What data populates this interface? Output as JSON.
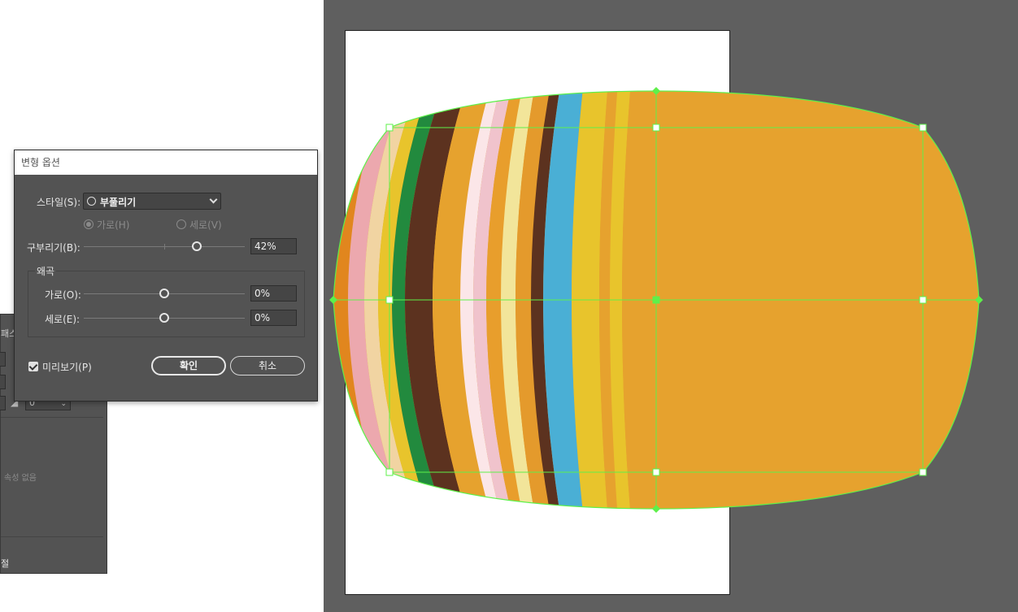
{
  "dialog": {
    "title": "변형 옵션",
    "style_label": "스타일(S):",
    "style_value": "부풀리기",
    "horizontal_radio_label": "가로(H)",
    "vertical_radio_label": "세로(V)",
    "bend_label": "구부리기(B):",
    "bend_value": "42%",
    "bend_fraction": 0.7,
    "distortion_group_label": "왜곡",
    "distort_h_label": "가로(O):",
    "distort_h_value": "0%",
    "distort_v_label": "세로(E):",
    "distort_v_value": "0%",
    "preview_label": "미리보기(P)",
    "preview_checked": true,
    "ok_label": "확인",
    "cancel_label": "취소"
  },
  "background_panel": {
    "tab_label": "패스",
    "field_value": "0",
    "empty_text": "속성 없음",
    "bottom_label": "절"
  },
  "artwork": {
    "selection_color": "#5ef04a",
    "fill_color": "#e6a22e",
    "stripes": [
      "#e1861e",
      "#eca8ae",
      "#f1d4a2",
      "#e8c42c",
      "#228a3e",
      "#5c321f",
      "#e6a22e",
      "#fbe6e8",
      "#f0c3cc",
      "#e89e2c",
      "#f2e59a",
      "#e49a2c",
      "#5c321f",
      "#4aafd5",
      "#e8c42c",
      "#e6a22e",
      "#e8c42c",
      "#e6a22e"
    ]
  }
}
